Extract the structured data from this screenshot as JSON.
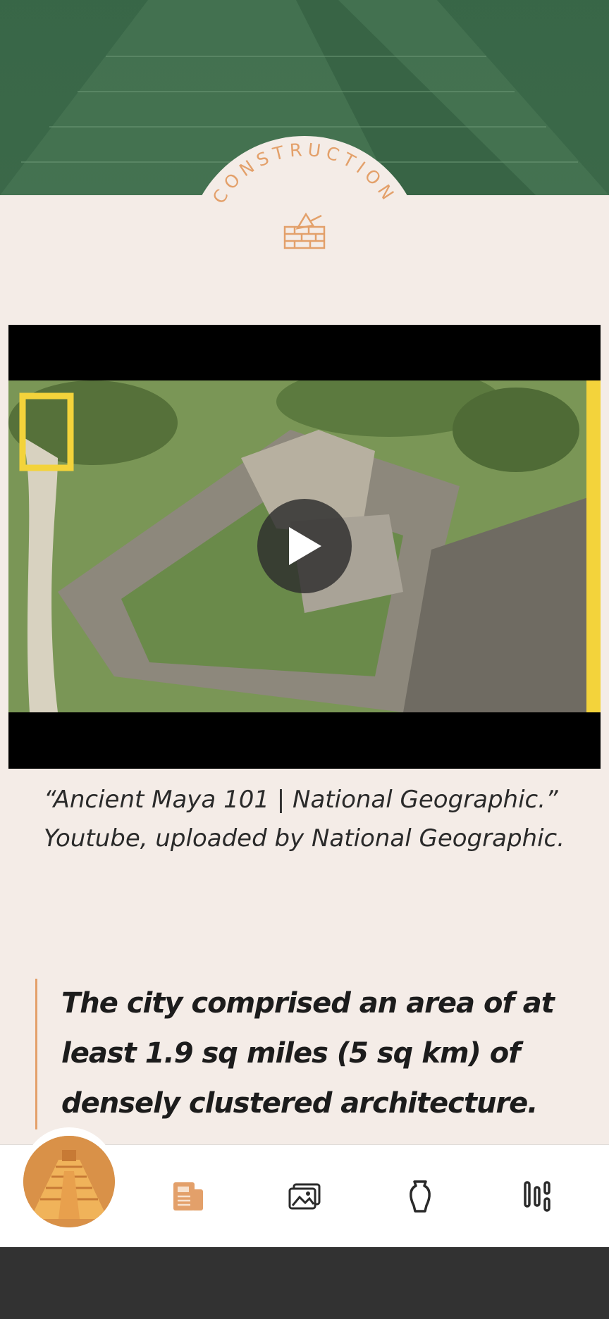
{
  "section": {
    "title": "CONSTRUCTION",
    "icon": "brick-trowel-icon",
    "accent_color": "#e3a06a"
  },
  "video": {
    "icon": "play-icon",
    "caption": "“Ancient Maya 101 | National Geographic.” Youtube, uploaded by National Geographic."
  },
  "quote": {
    "text": "The city comprised an area of at least 1.9 sq miles (5 sq km) of densely clustered architecture."
  },
  "nav": {
    "items": [
      {
        "name": "pyramid-logo",
        "active": true
      },
      {
        "name": "news-icon",
        "active": true
      },
      {
        "name": "gallery-icon",
        "active": false
      },
      {
        "name": "vase-icon",
        "active": false
      },
      {
        "name": "timeline-icon",
        "active": false
      }
    ]
  },
  "colors": {
    "hero_green": "#3d6a4a",
    "background": "#f4ece7",
    "accent": "#e3a06a"
  }
}
